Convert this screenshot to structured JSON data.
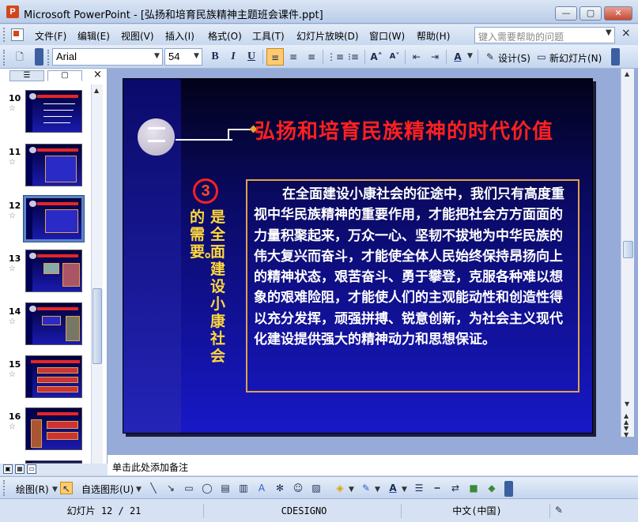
{
  "window": {
    "title": "Microsoft PowerPoint - [弘扬和培育民族精神主题班会课件.ppt]",
    "minimize_label": "—",
    "maximize_label": "▢",
    "close_label": "✕"
  },
  "menu": {
    "items": [
      "文件(F)",
      "编辑(E)",
      "视图(V)",
      "插入(I)",
      "格式(O)",
      "工具(T)",
      "幻灯片放映(D)",
      "窗口(W)",
      "帮助(H)"
    ],
    "help_placeholder": "键入需要帮助的问题",
    "close_glyph": "×"
  },
  "toolbar": {
    "font_name": "Arial",
    "font_size": "54",
    "bold": "B",
    "italic": "I",
    "underline": "U",
    "design_label": "设计(S)",
    "new_slide_label": "新幻灯片(N)",
    "alignment_selected": "left"
  },
  "left_pane": {
    "tab_outline_icon": "outline-icon",
    "tab_slides_icon": "slides-icon",
    "close_glyph": "×",
    "slides": [
      {
        "number": "10",
        "star": "☆"
      },
      {
        "number": "11",
        "star": "☆"
      },
      {
        "number": "12",
        "star": "☆",
        "selected": true
      },
      {
        "number": "13",
        "star": "☆"
      },
      {
        "number": "14",
        "star": "☆"
      },
      {
        "number": "15",
        "star": "☆"
      },
      {
        "number": "16",
        "star": "☆"
      }
    ]
  },
  "slide": {
    "badge": "3",
    "title": "弘扬和培育民族精神的时代价值",
    "vertical_col1": "是全面建设小康社会",
    "vertical_col2": "的需要。",
    "body": "在全面建设小康社会的征途中，我们只有高度重视中华民族精神的重要作用，才能把社会方方面面的力量积聚起来，万众一心、坚韧不拔地为中华民族的伟大复兴而奋斗，才能使全体人民始终保持昂扬向上的精神状态，艰苦奋斗、勇于攀登，克服各种难以想象的艰难险阻，才能使人们的主观能动性和创造性得以充分发挥，顽强拼搏、锐意创新，为社会主义现代化建设提供强大的精神动力和思想保证。",
    "colors": {
      "title": "#ff2020",
      "vertical_text": "#ffd83a",
      "box_border": "#e0a24a"
    }
  },
  "notes": {
    "placeholder": "单击此处添加备注"
  },
  "draw_toolbar": {
    "draw_label": "绘图(R)",
    "autoshapes_label": "自选图形(U)"
  },
  "status": {
    "slide_position": "幻灯片 12 / 21",
    "design_name": "CDESIGNO",
    "language": "中文(中国)"
  }
}
